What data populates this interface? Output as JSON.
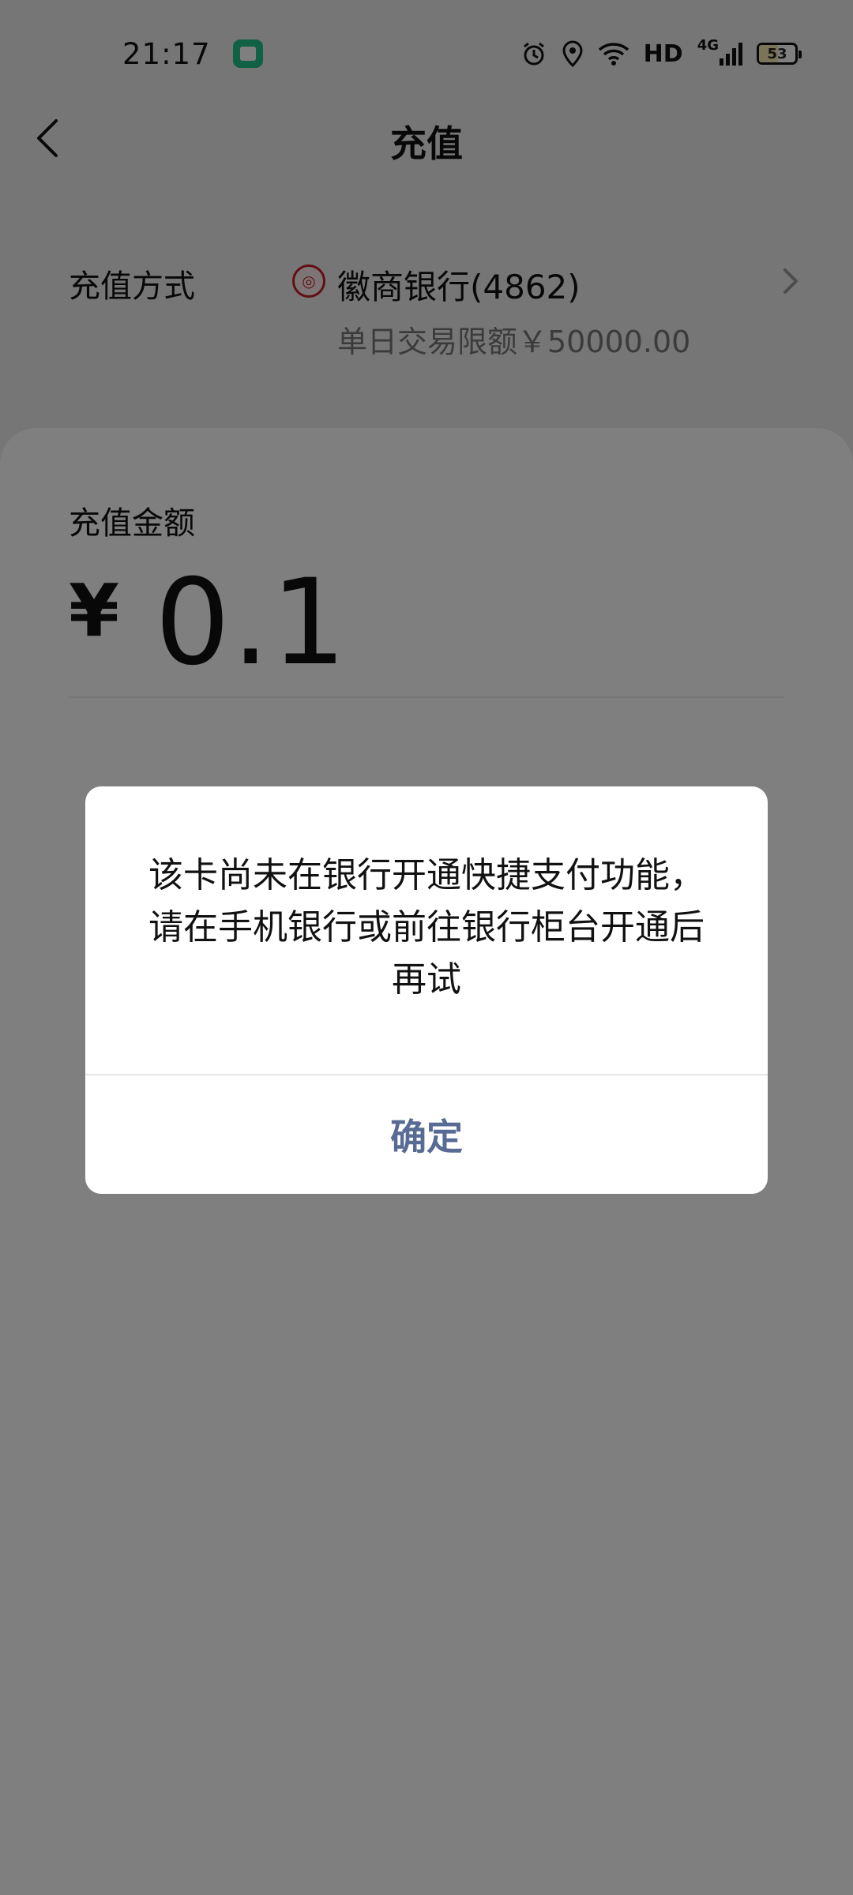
{
  "status_bar": {
    "time": "21:17",
    "hd_label": "HD",
    "network_label": "4G",
    "battery_level": "53"
  },
  "nav": {
    "title": "充值"
  },
  "method": {
    "label": "充值方式",
    "bank_name": "徽商银行(4862)",
    "limit_text": "单日交易限额￥50000.00"
  },
  "amount": {
    "label": "充值金额",
    "currency": "¥",
    "value": "0.1"
  },
  "dialog": {
    "message": "该卡尚未在银行开通快捷支付功能，请在手机银行或前往银行柜台开通后再试",
    "confirm_label": "确定"
  },
  "colors": {
    "link_blue": "#576b95",
    "app_badge_green": "#23c58a",
    "bank_red": "#c21f2a"
  }
}
